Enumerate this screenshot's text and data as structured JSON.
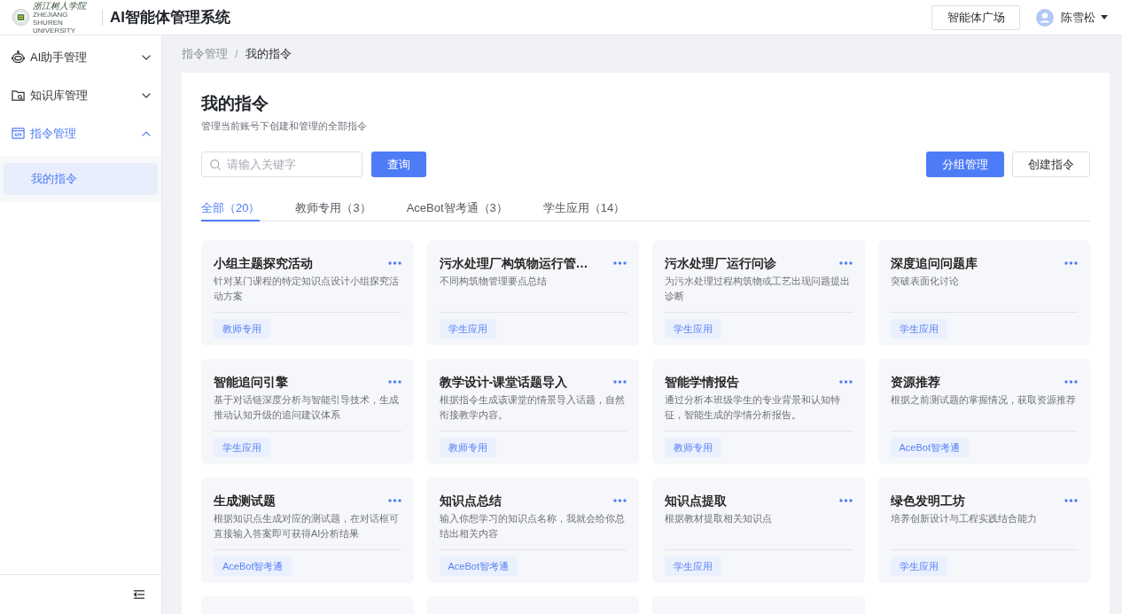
{
  "header": {
    "logo": {
      "name": "浙江树人学院",
      "subtitle": "ZHEJIANG SHUREN UNIVERSITY"
    },
    "title": "AI智能体管理系统",
    "plaza_button": "智能体广场",
    "user": {
      "name": "陈雪松"
    }
  },
  "sidebar": {
    "items": [
      {
        "kind": "robot",
        "label": "AI助手管理",
        "expanded": false
      },
      {
        "kind": "folder",
        "label": "知识库管理",
        "expanded": false
      },
      {
        "kind": "code",
        "label": "指令管理",
        "expanded": true,
        "children": [
          {
            "label": "我的指令",
            "selected": true
          }
        ]
      }
    ]
  },
  "breadcrumb": {
    "items": [
      "指令管理",
      "我的指令"
    ],
    "separator": "/"
  },
  "page": {
    "title": "我的指令",
    "subtitle": "管理当前账号下创建和管理的全部指令"
  },
  "search": {
    "placeholder": "请输入关键字",
    "button": "查询"
  },
  "actions": [
    {
      "label": "分组管理",
      "kind": "primary"
    },
    {
      "label": "创建指令",
      "kind": "default"
    }
  ],
  "tabs": [
    {
      "label": "全部（20）",
      "selected": true
    },
    {
      "label": "教师专用（3）",
      "selected": false
    },
    {
      "label": "AceBot智考通（3）",
      "selected": false
    },
    {
      "label": "学生应用（14）",
      "selected": false
    }
  ],
  "cards": [
    {
      "kind": "full",
      "title": "小组主题探究活动",
      "description": "针对某门课程的特定知识点设计小组探究活动方案",
      "tag": "教师专用"
    },
    {
      "kind": "full",
      "title": "污水处理厂构筑物运行管…",
      "description": "不同构筑物管理要点总结",
      "tag": "学生应用"
    },
    {
      "kind": "full",
      "title": "污水处理厂运行问诊",
      "description": "为污水处理过程构筑物或工艺出现问题提出诊断",
      "tag": "学生应用"
    },
    {
      "kind": "full",
      "title": "深度追问问题库",
      "description": "突破表面化讨论",
      "tag": "学生应用"
    },
    {
      "kind": "full",
      "title": "智能追问引擎",
      "description": "基于对话链深度分析与智能引导技术，生成推动认知升级的追问建议体系",
      "tag": "学生应用"
    },
    {
      "kind": "full",
      "title": "教学设计-课堂话题导入",
      "description": "根据指令生成该课堂的情景导入话题，自然衔接教学内容。",
      "tag": "教师专用"
    },
    {
      "kind": "full",
      "title": "智能学情报告",
      "description": "通过分析本班级学生的专业背景和认知特征，智能生成的学情分析报告。",
      "tag": "教师专用"
    },
    {
      "kind": "full",
      "title": "资源推荐",
      "description": "根据之前测试题的掌握情况，获取资源推荐",
      "tag": "AceBot智考通"
    },
    {
      "kind": "full",
      "title": "生成测试题",
      "description": "根据知识点生成对应的测试题，在对话框可直接输入答案即可获得AI分析结果",
      "tag": "AceBot智考通"
    },
    {
      "kind": "full",
      "title": "知识点总结",
      "description": "输入你想学习的知识点名称，我就会给你总结出相关内容",
      "tag": "AceBot智考通"
    },
    {
      "kind": "full",
      "title": "知识点提取",
      "description": "根据教材提取相关知识点",
      "tag": "学生应用"
    },
    {
      "kind": "full",
      "title": "绿色发明工坊",
      "description": "培养创新设计与工程实践结合能力",
      "tag": "学生应用"
    },
    {
      "kind": "clipped"
    },
    {
      "kind": "clipped"
    },
    {
      "kind": "clipped"
    }
  ]
}
